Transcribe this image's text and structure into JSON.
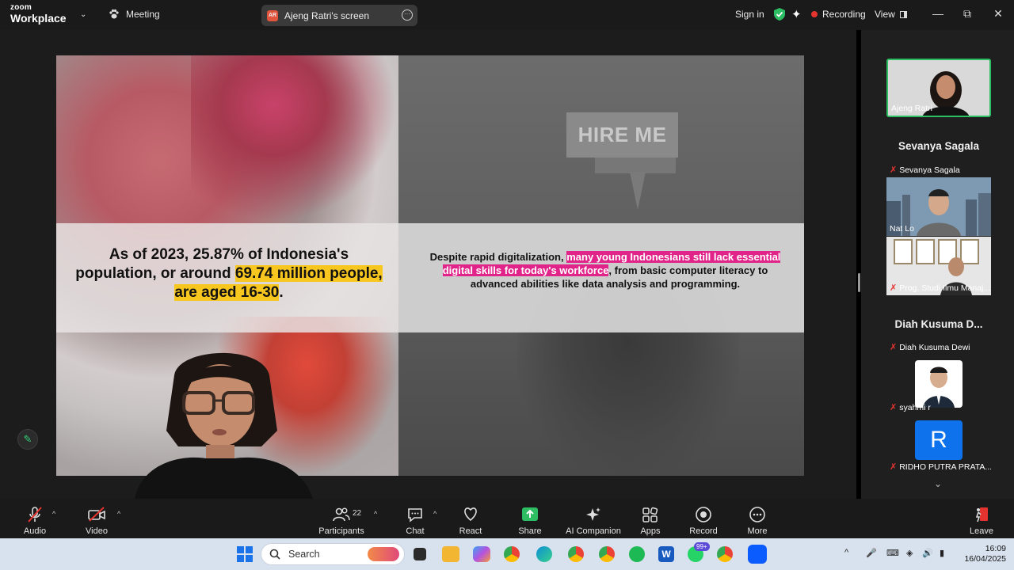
{
  "app": {
    "brand_small": "zoom",
    "brand_big": "Workplace",
    "meeting_label": "Meeting",
    "screen_owner_label": "Ajeng Ratri's screen",
    "screen_owner_initials": "AR",
    "sign_in": "Sign in",
    "recording": "Recording",
    "view": "View"
  },
  "slide": {
    "stat_line_1": "As of 2023, 25.87% of Indonesia's",
    "stat_line_2": "population, or around ",
    "stat_highlight": "69.74 million people, are aged 16-30",
    "stat_end": ".",
    "desc_start": "Despite rapid digitalization, ",
    "desc_highlight": "many young Indonesians still lack essential digital skills for today's workforce",
    "desc_end": ", from basic computer literacy to advanced abilities like data analysis and programming.",
    "sign_text": "HIRE ME"
  },
  "participants_panel": {
    "tiles": [
      {
        "name": "Ajeng Ratri",
        "muted": false
      },
      {
        "name": "Sevanya Sagala",
        "title": "Sevanya Sagala",
        "muted": true
      },
      {
        "name": "Nat Lo",
        "muted": false
      },
      {
        "name": "Prog. Studi Ilmu Manaj...",
        "muted": true
      },
      {
        "name": "Diah Kusuma Dewi",
        "title": "Diah Kusuma D...",
        "muted": true
      },
      {
        "name": "syahmi r",
        "muted": true
      },
      {
        "name": "RIDHO PUTRA PRATA...",
        "initial": "R",
        "muted": true
      }
    ]
  },
  "toolbar": {
    "audio": "Audio",
    "video": "Video",
    "participants": "Participants",
    "participants_count": "22",
    "chat": "Chat",
    "react": "React",
    "share": "Share",
    "ai_companion": "AI Companion",
    "apps": "Apps",
    "record": "Record",
    "more": "More",
    "leave": "Leave"
  },
  "taskbar": {
    "search_placeholder": "Search",
    "time": "16:09",
    "date": "16/04/2025",
    "whatsapp_badge": "99+"
  },
  "colors": {
    "accent_green": "#2dbd63",
    "highlight_yellow": "#f7c61f",
    "highlight_pink": "#e0248a",
    "record_red": "#e5342f"
  }
}
